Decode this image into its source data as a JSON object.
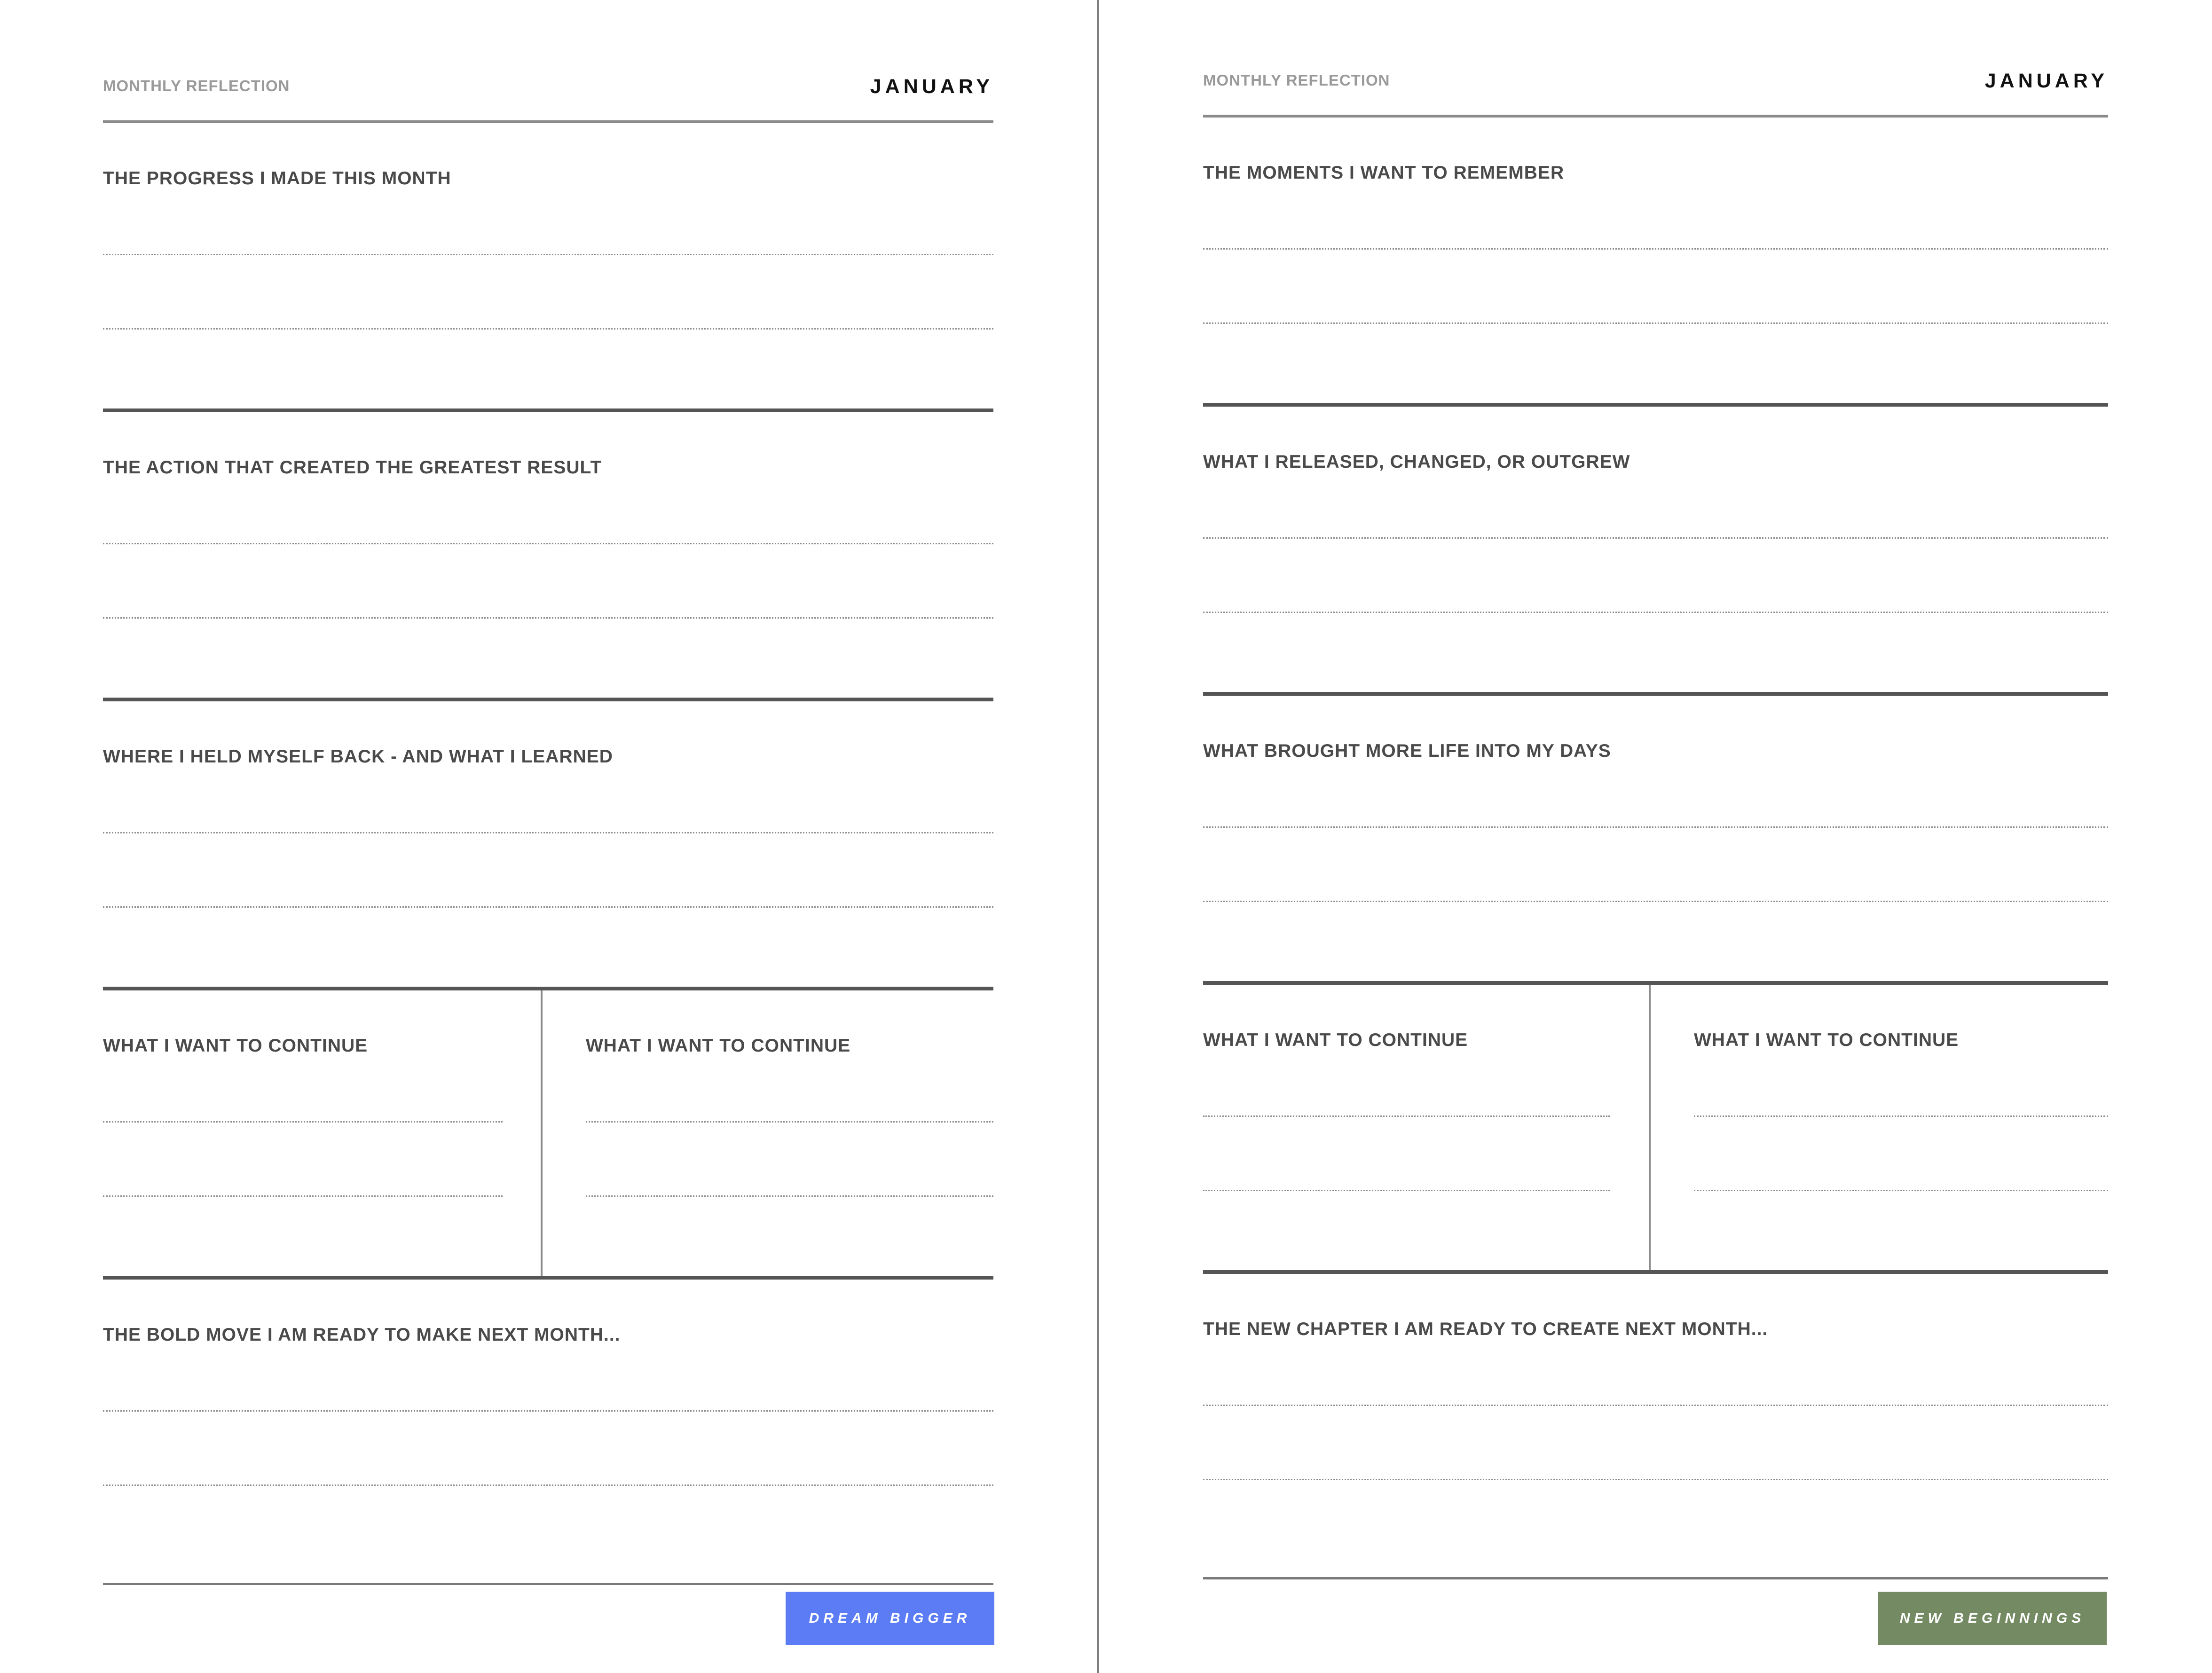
{
  "left": {
    "header_label": "MONTHLY REFLECTION",
    "month": "JANUARY",
    "sections": [
      {
        "title": "THE PROGRESS I MADE THIS MONTH"
      },
      {
        "title": "THE ACTION THAT CREATED THE GREATEST RESULT"
      },
      {
        "title": "WHERE I HELD MYSELF BACK - AND WHAT I LEARNED"
      }
    ],
    "split": [
      {
        "title": "WHAT I WANT TO CONTINUE"
      },
      {
        "title": "WHAT I WANT TO CONTINUE"
      }
    ],
    "final": {
      "title": "THE BOLD MOVE I AM READY TO MAKE NEXT MONTH..."
    },
    "badge": {
      "text": "DREAM BIGGER",
      "color": "#5b7cf5"
    }
  },
  "right": {
    "header_label": "MONTHLY REFLECTION",
    "month": "JANUARY",
    "sections": [
      {
        "title": "THE MOMENTS I WANT TO REMEMBER"
      },
      {
        "title": "WHAT I RELEASED, CHANGED, OR OUTGREW"
      },
      {
        "title": "WHAT BROUGHT MORE LIFE INTO MY DAYS"
      }
    ],
    "split": [
      {
        "title": "WHAT I WANT TO CONTINUE"
      },
      {
        "title": "WHAT I WANT TO CONTINUE"
      }
    ],
    "final": {
      "title": "THE NEW CHAPTER I AM READY TO CREATE NEXT MONTH..."
    },
    "badge": {
      "text": "NEW BEGINNINGS",
      "color": "#748a63"
    }
  }
}
